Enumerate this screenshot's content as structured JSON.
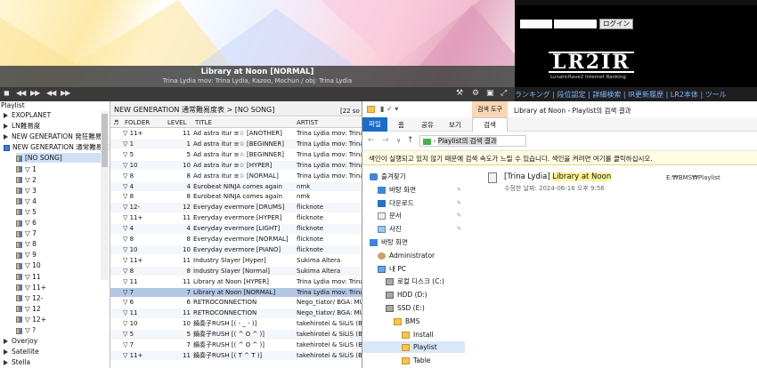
{
  "player": {
    "title": "Library at Noon [NORMAL]",
    "subtitle": "Trina Lydia mov: Trina Lydia, Kazoo, Mochun / obj: Trina Lydia",
    "controls": [
      "◼",
      "◀◀",
      "▶▶",
      "◀◀",
      "▶▶"
    ]
  },
  "lr2ir": {
    "login_label": "ログイン",
    "logo": "LR2IR",
    "tagline": "LunaticRave2 Internet Ranking",
    "nav": "ランキング | 段位認定 | 詳細検索 | IR更新履歴 | LR2本体 | ツール"
  },
  "sidebar": {
    "header": "Playlist",
    "items": [
      {
        "label": "EXOPLANET",
        "type": "arrow"
      },
      {
        "label": "LN難易度",
        "type": "arrow"
      },
      {
        "label": "NEW GENERATION 発狂難易度",
        "type": "arrow"
      },
      {
        "label": "NEW GENERATION 通常難易度",
        "type": "open"
      },
      {
        "label": "[NO SONG]",
        "type": "half"
      },
      {
        "label": "▽ 1",
        "type": "half"
      },
      {
        "label": "▽ 2",
        "type": "half"
      },
      {
        "label": "▽ 3",
        "type": "half"
      },
      {
        "label": "▽ 4",
        "type": "half"
      },
      {
        "label": "▽ 5",
        "type": "half"
      },
      {
        "label": "▽ 6",
        "type": "half"
      },
      {
        "label": "▽ 7",
        "type": "half"
      },
      {
        "label": "▽ 8",
        "type": "half"
      },
      {
        "label": "▽ 9",
        "type": "half"
      },
      {
        "label": "▽ 10",
        "type": "half"
      },
      {
        "label": "▽ 11",
        "type": "half"
      },
      {
        "label": "▽ 11+",
        "type": "half"
      },
      {
        "label": "▽ 12-",
        "type": "half"
      },
      {
        "label": "▽ 12",
        "type": "half"
      },
      {
        "label": "▽ 12+",
        "type": "half"
      },
      {
        "label": "▽ ?",
        "type": "half"
      },
      {
        "label": "Overjoy",
        "type": "arrow"
      },
      {
        "label": "Satellite",
        "type": "arrow"
      },
      {
        "label": "Stella",
        "type": "arrow"
      }
    ]
  },
  "songlist": {
    "breadcrumb": "NEW GENERATION 通常難易度表 > [NO SONG]",
    "count": "[22 so",
    "columns": {
      "folder": "FOLDER",
      "level": "LEVEL",
      "title": "TITLE",
      "artist": "ARTIST"
    },
    "rows": [
      {
        "folder": "▽ 11+",
        "level": "11",
        "title": "Ad astra itur ≡☆ [ANOTHER]",
        "artist": "Trina Lydia mov: Trina"
      },
      {
        "folder": "▽ 1",
        "level": "1",
        "title": "Ad astra itur ≡☆ [BEGINNER]",
        "artist": "Trina Lydia mov: Trina"
      },
      {
        "folder": "▽ 5",
        "level": "5",
        "title": "Ad astra itur ≡☆ [BEGINNER]",
        "artist": "Trina Lydia mov: Trina"
      },
      {
        "folder": "▽ 10",
        "level": "10",
        "title": "Ad astra itur ≡☆ [HYPER]",
        "artist": "Trina Lydia mov: Trina"
      },
      {
        "folder": "▽ 8",
        "level": "8",
        "title": "Ad astra itur ≡☆ [NORMAL]",
        "artist": "Trina Lydia mov: Trina"
      },
      {
        "folder": "▽ 4",
        "level": "4",
        "title": "Eurobeat NINJA comes again",
        "artist": "nmk"
      },
      {
        "folder": "▽ 8",
        "level": "8",
        "title": "Eurobeat NINJA comes again",
        "artist": "nmk"
      },
      {
        "folder": "▽ 12-",
        "level": "12",
        "title": "Everyday evermore [DRUMS]",
        "artist": "flicknote"
      },
      {
        "folder": "▽ 11+",
        "level": "11",
        "title": "Everyday evermore [HYPER]",
        "artist": "flicknote"
      },
      {
        "folder": "▽ 4",
        "level": "4",
        "title": "Everyday evermore [LIGHT]",
        "artist": "flicknote"
      },
      {
        "folder": "▽ 8",
        "level": "8",
        "title": "Everyday evermore [NORMAL]",
        "artist": "flicknote"
      },
      {
        "folder": "▽ 10",
        "level": "10",
        "title": "Everyday evermore [PIANO]",
        "artist": "flicknote"
      },
      {
        "folder": "▽ 11+",
        "level": "11",
        "title": "Industry Slayer [Hyper]",
        "artist": "Sukima Altera"
      },
      {
        "folder": "▽ 8",
        "level": "8",
        "title": "Industry Slayer [Normal]",
        "artist": "Sukima Altera"
      },
      {
        "folder": "▽ 11",
        "level": "11",
        "title": "Library at Noon [HYPER]",
        "artist": "Trina Lydia mov: Trina"
      },
      {
        "folder": "▽ 7",
        "level": "7",
        "title": "Library at Noon [NORMAL]",
        "artist": "Trina Lydia mov: Trina",
        "selected": true
      },
      {
        "folder": "▽ 6",
        "level": "6",
        "title": "RETROCONNECTION",
        "artist": "Nego_tiator/ BGA: MU"
      },
      {
        "folder": "▽ 11",
        "level": "11",
        "title": "RETROCONNECTION",
        "artist": "Nego_tiator/ BGA: MU"
      },
      {
        "folder": "▽ 10",
        "level": "10",
        "title": "鍋奏子RUSH [( - _ - )]",
        "artist": "takehirotei & SiLiS (BG"
      },
      {
        "folder": "▽ 5",
        "level": "5",
        "title": "鍋奏子RUSH [( ^ O ^ )]",
        "artist": "takehirotei & SiLiS (BG"
      },
      {
        "folder": "▽ 7",
        "level": "7",
        "title": "鍋奏子RUSH [( ^ O ^ )]",
        "artist": "takehirotei & SiLiS (BG"
      },
      {
        "folder": "▽ 11+",
        "level": "11",
        "title": "鍋奏子RUSH [( T ^ T )]",
        "artist": "takehirotei & SiLiS (BG"
      }
    ]
  },
  "explorer": {
    "title": "Library at Noon - Playlist의 검색 결과",
    "search_tools_tab": "검색 도구",
    "tabs": [
      "파일",
      "홈",
      "공유",
      "보기",
      "검색"
    ],
    "address": "Playlist의 검색 결과",
    "info_bar": "색인이 실행되고 있지 않기 때문에 검색 속도가 느릴 수 있습니다. 색인을 켜려면 여기를 클릭하십시오.",
    "nav_items": [
      {
        "label": "즐겨찾기",
        "icon": "star-icon",
        "indent": 0
      },
      {
        "label": "바탕 화면",
        "icon": "desktop-icon",
        "indent": 1,
        "pinned": true
      },
      {
        "label": "다운로드",
        "icon": "download-icon",
        "indent": 1,
        "pinned": true
      },
      {
        "label": "문서",
        "icon": "document-icon",
        "indent": 1,
        "pinned": true
      },
      {
        "label": "사진",
        "icon": "picture-icon",
        "indent": 1,
        "pinned": true
      },
      {
        "label": "바탕 화면",
        "icon": "desktop-icon",
        "indent": 0
      },
      {
        "label": "Administrator",
        "icon": "user-icon",
        "indent": 1
      },
      {
        "label": "내 PC",
        "icon": "pc-icon",
        "indent": 1
      },
      {
        "label": "로컬 디스크 (C:)",
        "icon": "disk-icon",
        "indent": 2
      },
      {
        "label": "HDD (D:)",
        "icon": "disk-icon",
        "indent": 2
      },
      {
        "label": "SSD (E:)",
        "icon": "disk-icon",
        "indent": 2
      },
      {
        "label": "BMS",
        "icon": "folder-icon",
        "indent": 3
      },
      {
        "label": "Install",
        "icon": "folder-icon",
        "indent": 4
      },
      {
        "label": "Playlist",
        "icon": "folder-icon",
        "indent": 4,
        "selected": true
      },
      {
        "label": "Table",
        "icon": "folder-icon",
        "indent": 4
      }
    ],
    "result": {
      "name_prefix": "[Trina Lydia] ",
      "name_highlight": "Library at Noon",
      "modified": "수정한 날짜: 2024-06-16 오후 9:56",
      "path": "E:₩BMS₩Playlist"
    }
  },
  "colors": {
    "accent": "#3d86d8",
    "selection": "#b4c8e6",
    "highlight": "#fff59a"
  }
}
